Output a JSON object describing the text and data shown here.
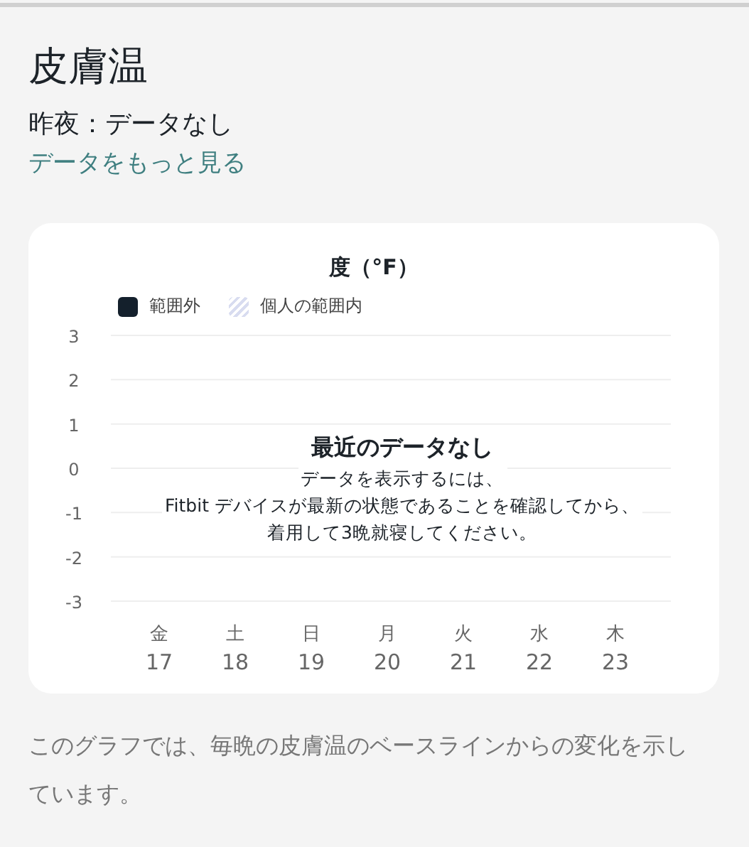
{
  "title": "皮膚温",
  "last_night": "昨夜：データなし",
  "more_link": "データをもっと見る",
  "chart_card": {
    "legend": [
      {
        "kind": "solid",
        "label": "範囲外"
      },
      {
        "kind": "hatched",
        "label": "個人の範囲内"
      }
    ],
    "empty_message": {
      "title": "最近のデータなし",
      "lines": [
        "データを表示するには、",
        "Fitbit デバイスが最新の状態であることを確認してから、",
        "着用して3晩就寝してください。"
      ]
    },
    "weekdays": [
      "金",
      "土",
      "日",
      "月",
      "火",
      "水",
      "木"
    ],
    "chart_data": {
      "type": "bar",
      "title": "度（°F）",
      "categories": [
        "17",
        "18",
        "19",
        "20",
        "21",
        "22",
        "23"
      ],
      "values": [
        null,
        null,
        null,
        null,
        null,
        null,
        null
      ],
      "ylim": [
        -3,
        3
      ],
      "grid": true,
      "yticks": [
        3,
        2,
        1,
        0,
        -1,
        -2,
        -3
      ]
    }
  },
  "description": "このグラフでは、毎晩の皮膚温のベースラインからの変化を示しています。"
}
